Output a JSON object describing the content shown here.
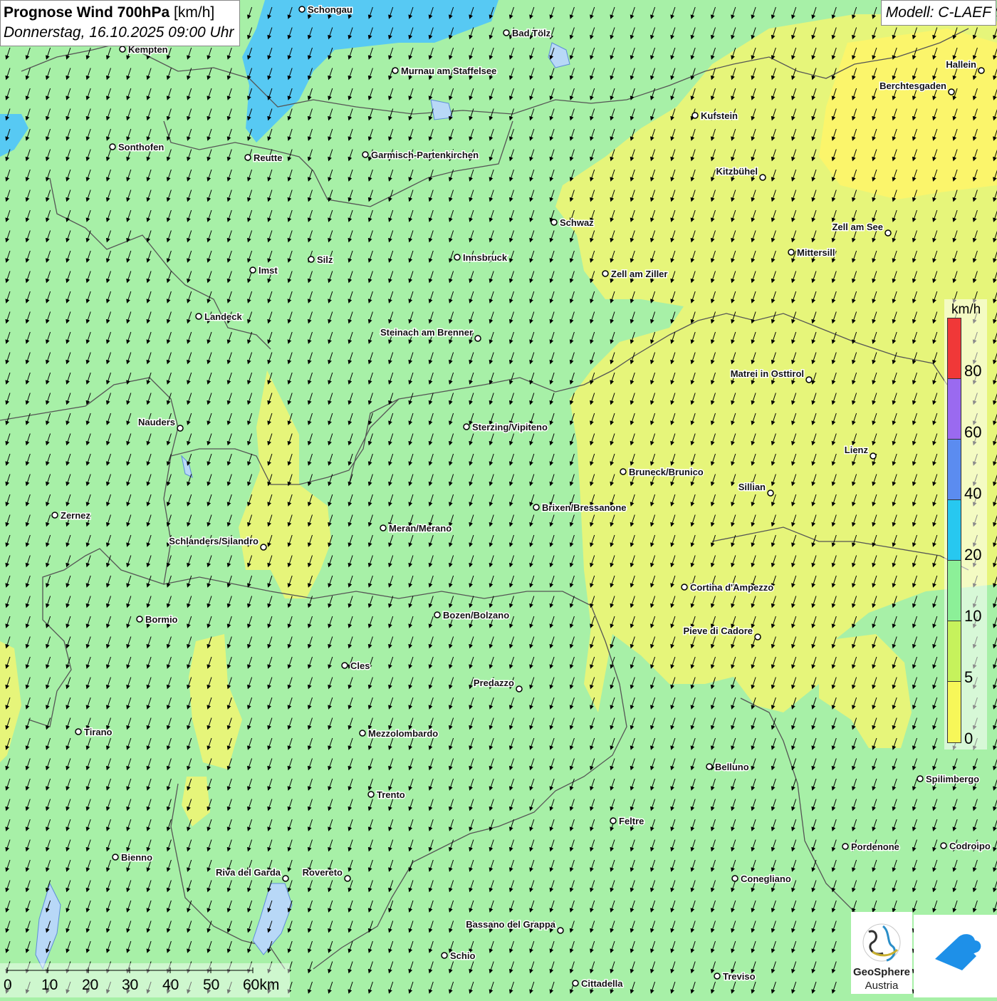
{
  "header": {
    "title_bold": "Prognose Wind 700hPa",
    "title_unit": " [km/h]",
    "datetime": "Donnerstag, 16.10.2025 09:00 Uhr"
  },
  "model": {
    "label": "Modell: C-LAEF"
  },
  "legend": {
    "unit": "km/h",
    "ticks": [
      {
        "label": "0",
        "color": "#f7f759"
      },
      {
        "label": "5",
        "color": "#c6f25c"
      },
      {
        "label": "10",
        "color": "#8cf098"
      },
      {
        "label": "20",
        "color": "#27c8f0"
      },
      {
        "label": "40",
        "color": "#5b8cf0"
      },
      {
        "label": "60",
        "color": "#9a6af0"
      },
      {
        "label": "80",
        "color": "#f03838"
      }
    ]
  },
  "scale": {
    "labels": [
      "0",
      "10",
      "20",
      "30",
      "40",
      "50",
      "60km"
    ]
  },
  "logo": {
    "line1": "GeoSphere",
    "line2": "Austria"
  },
  "wind": {
    "direction": "north (arrows point south)",
    "typical_speed_band": "5-10 km/h"
  },
  "cities": [
    {
      "name": "Schongau"
    },
    {
      "name": "Bad Tölz"
    },
    {
      "name": "Kempten"
    },
    {
      "name": "Murnau am Staffelsee"
    },
    {
      "name": "Hallein"
    },
    {
      "name": "Berchtesgaden"
    },
    {
      "name": "Kufstein"
    },
    {
      "name": "Sonthofen"
    },
    {
      "name": "Reutte"
    },
    {
      "name": "Garmisch-Partenkirchen"
    },
    {
      "name": "Kitzbühel"
    },
    {
      "name": "Schwaz"
    },
    {
      "name": "Zell am See"
    },
    {
      "name": "Mittersill"
    },
    {
      "name": "Silz"
    },
    {
      "name": "Innsbruck"
    },
    {
      "name": "Imst"
    },
    {
      "name": "Zell am Ziller"
    },
    {
      "name": "Landeck"
    },
    {
      "name": "Steinach am Brenner"
    },
    {
      "name": "Matrei in Osttirol"
    },
    {
      "name": "Nauders"
    },
    {
      "name": "Sterzing/Vipiteno"
    },
    {
      "name": "Lienz"
    },
    {
      "name": "Bruneck/Brunico"
    },
    {
      "name": "Sillian"
    },
    {
      "name": "Zernez"
    },
    {
      "name": "Brixen/Bressanone"
    },
    {
      "name": "Meran/Merano"
    },
    {
      "name": "Schlanders/Silandro"
    },
    {
      "name": "Cortina d'Ampezzo"
    },
    {
      "name": "Bormio"
    },
    {
      "name": "Bozen/Bolzano"
    },
    {
      "name": "Pieve di Cadore"
    },
    {
      "name": "Cles"
    },
    {
      "name": "Predazzo"
    },
    {
      "name": "Tirano"
    },
    {
      "name": "Mezzolombardo"
    },
    {
      "name": "Belluno"
    },
    {
      "name": "Spilimbergo"
    },
    {
      "name": "Trento"
    },
    {
      "name": "Feltre"
    },
    {
      "name": "Pordenone"
    },
    {
      "name": "Codroipo"
    },
    {
      "name": "Bienno"
    },
    {
      "name": "Riva del Garda"
    },
    {
      "name": "Rovereto"
    },
    {
      "name": "Conegliano"
    },
    {
      "name": "Bassano del Grappa"
    },
    {
      "name": "Schio"
    },
    {
      "name": "Cittadella"
    },
    {
      "name": "Treviso"
    }
  ]
}
